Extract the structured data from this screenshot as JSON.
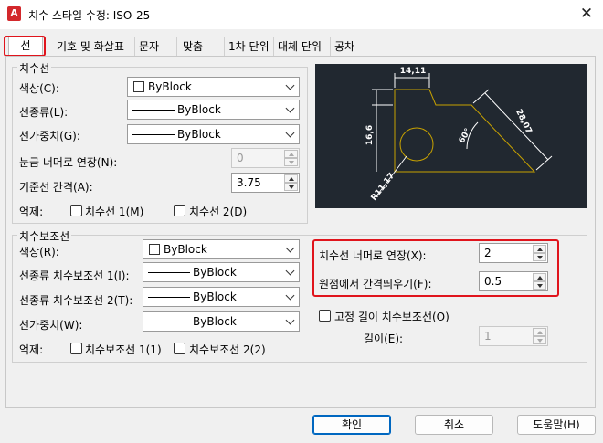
{
  "window": {
    "title": "치수 스타일 수정: ISO-25",
    "app_icon_letter": "A"
  },
  "tabs": [
    "선",
    "기호 및 화살표",
    "문자",
    "맞춤",
    "1차 단위",
    "대체 단위",
    "공차"
  ],
  "dimension_lines": {
    "group_label": "치수선",
    "color_label": "색상(C):",
    "color_value": "ByBlock",
    "linetype_label": "선종류(L):",
    "linetype_value": "ByBlock",
    "lineweight_label": "선가중치(G):",
    "lineweight_value": "ByBlock",
    "extend_ticks_label": "눈금 너머로 연장(N):",
    "extend_ticks_value": "0",
    "baseline_spacing_label": "기준선 간격(A):",
    "baseline_spacing_value": "3.75",
    "suppress_label": "억제:",
    "suppress_dim1": "치수선 1(M)",
    "suppress_dim2": "치수선 2(D)"
  },
  "extension_lines": {
    "group_label": "치수보조선",
    "color_label": "색상(R):",
    "color_value": "ByBlock",
    "linetype1_label": "선종류 치수보조선 1(I):",
    "linetype1_value": "ByBlock",
    "linetype2_label": "선종류 치수보조선 2(T):",
    "linetype2_value": "ByBlock",
    "lineweight_label": "선가중치(W):",
    "lineweight_value": "ByBlock",
    "suppress_label": "억제:",
    "suppress_ext1": "치수보조선 1(1)",
    "suppress_ext2": "치수보조선 2(2)",
    "extend_beyond_label": "치수선 너머로 연장(X):",
    "extend_beyond_value": "2",
    "offset_origin_label": "원점에서 간격띄우기(F):",
    "offset_origin_value": "0.5",
    "fixed_length_label": "고정 길이 치수보조선(O)",
    "length_label": "길이(E):",
    "length_value": "1"
  },
  "preview": {
    "dim_top": "14,11",
    "dim_left": "16,6",
    "dim_right": "28,07",
    "dim_angle": "60°",
    "dim_radius": "R11,17"
  },
  "footer": {
    "ok": "확인",
    "cancel": "취소",
    "help": "도움말(H)"
  },
  "colors": {
    "highlight": "#e0141c",
    "preview_bg": "#212830",
    "preview_geometry": "#c8a200",
    "preview_dims": "#ffffff"
  }
}
